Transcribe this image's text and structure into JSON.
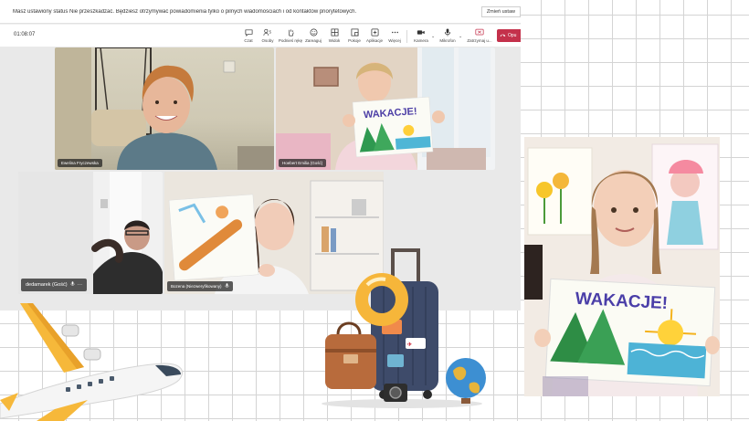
{
  "banner": {
    "message": "Masz ustawiony status Nie przeszkadzać. Będziesz otrzymywać powiadomienia tylko o pilnych wiadomościach i od kontaktów priorytetowych.",
    "change_label": "Zmień ustaw"
  },
  "toolbar": {
    "timer": "01:08:07",
    "chat": "Czat",
    "people": "Osoby",
    "people_count": "5",
    "raise_hand": "Podnieś rękę",
    "reactions": "Zareaguj",
    "view": "Widok",
    "rooms": "Pokoje",
    "apps": "Aplikacje",
    "more": "Więcej",
    "camera": "Kamera",
    "mic": "Mikrofon",
    "share": "Zatrzymaj u...",
    "leave": "Opu"
  },
  "participants": [
    {
      "name": "Ewelina Fryczewska"
    },
    {
      "name": "Hoebert Emilia (Gość)"
    },
    {
      "name": "dedamarek (Gość)"
    },
    {
      "name": "Bozena (Niezweryfikowany)"
    }
  ],
  "drawing_text": "WAKACJE!",
  "icons": [
    "chat-icon",
    "people-icon",
    "hand-icon",
    "smile-icon",
    "grid-icon",
    "rooms-icon",
    "apps-icon",
    "more-icon",
    "camera-icon",
    "mic-icon",
    "share-icon",
    "phone-icon"
  ],
  "colors": {
    "leave_red": "#c4314b",
    "banner_bg": "#ffffff",
    "grid_line": "#d4d4d4"
  }
}
